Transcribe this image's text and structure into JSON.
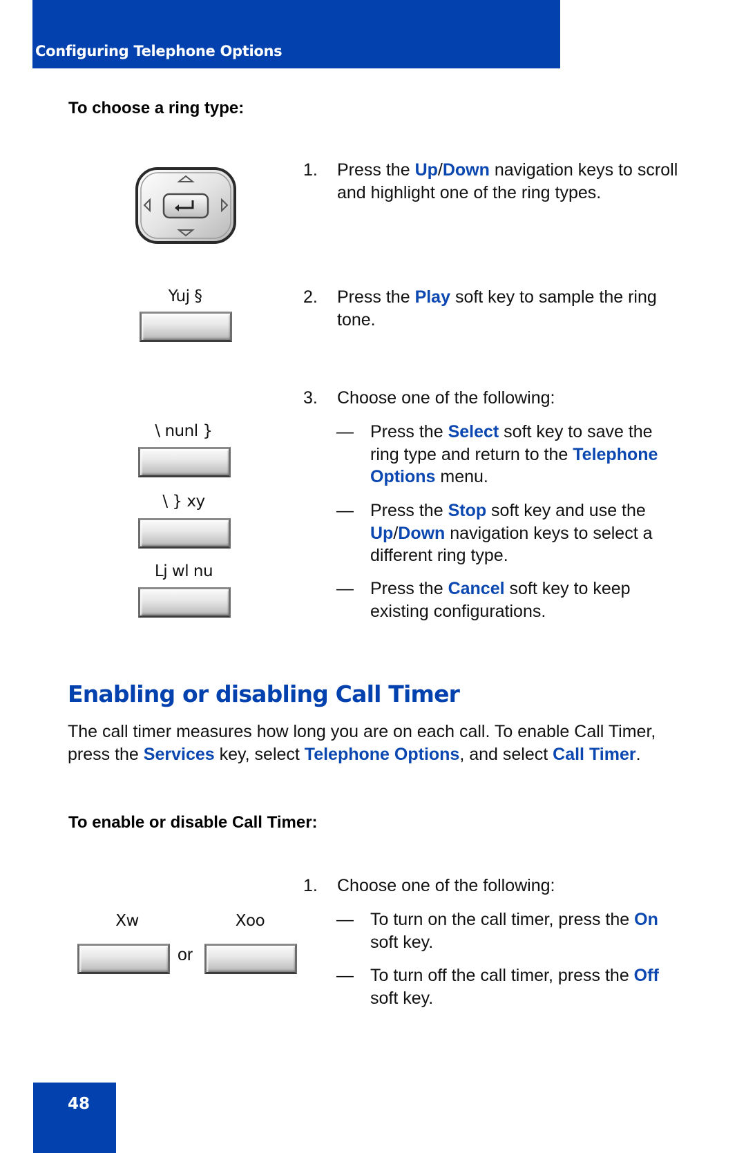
{
  "header": {
    "title": "Configuring Telephone Options"
  },
  "ring_type": {
    "heading": "To choose a ring type:",
    "steps": [
      {
        "num": "1.",
        "parts": [
          "Press the ",
          "Up",
          "/",
          "Down",
          " navigation keys to scroll and highlight one of the ring types."
        ]
      },
      {
        "num": "2.",
        "parts": [
          "Press the ",
          "Play",
          " soft key to sample the ring tone."
        ]
      },
      {
        "num": "3.",
        "text": "Choose one of the following:"
      }
    ],
    "options": [
      {
        "dash": "—",
        "parts": [
          "Press the ",
          "Select",
          " soft key to save the ring type and return to the ",
          "Telephone Options",
          " menu."
        ]
      },
      {
        "dash": "—",
        "parts": [
          "Press the ",
          "Stop",
          " soft key and use the ",
          "Up",
          "/",
          "Down",
          " navigation keys to select a different ring type."
        ]
      },
      {
        "dash": "—",
        "parts": [
          "Press the ",
          "Cancel",
          " soft key to keep existing configurations."
        ]
      }
    ],
    "softkeys": {
      "play": "Yuj §",
      "select": "\\ nunl }",
      "stop": "\\ } xy",
      "cancel": "Lj wl nu"
    },
    "nav_key_icon": "navigation-cluster-icon"
  },
  "call_timer": {
    "title": "Enabling or disabling Call Timer",
    "intro_parts": [
      "The call timer measures how long you are on each call. To enable Call Timer, press the ",
      "Services",
      " key, select ",
      "Telephone Options",
      ", and select ",
      "Call Timer",
      "."
    ],
    "heading": "To enable or disable Call Timer:",
    "step": {
      "num": "1.",
      "text": "Choose one of the following:"
    },
    "options": [
      {
        "dash": "—",
        "parts": [
          "To turn on the call timer, press the ",
          "On",
          " soft key."
        ]
      },
      {
        "dash": "—",
        "parts": [
          "To turn off the call timer, press the ",
          "Off",
          " soft key."
        ]
      }
    ],
    "softkeys": {
      "on": "Xw",
      "off": "Xoo"
    },
    "or_label": "or"
  },
  "page_number": "48",
  "colors": {
    "brand_blue": "#0341ae",
    "highlight_blue": "#0a47b0"
  }
}
